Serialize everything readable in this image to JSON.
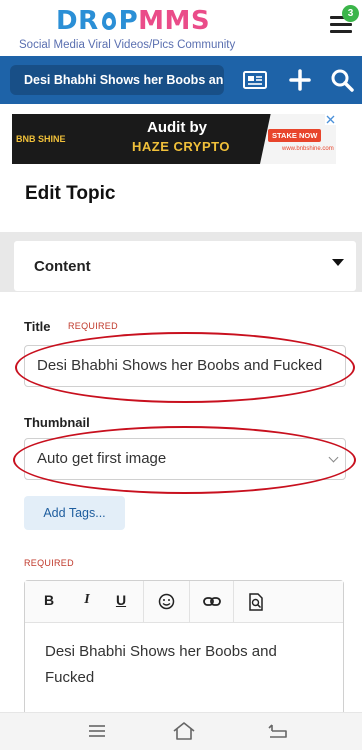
{
  "header": {
    "logo_left": "DR",
    "logo_mid": "P",
    "logo_right": "MMS",
    "tagline": "Social Media Viral Videos/Pics Community",
    "notification_count": "3"
  },
  "topbar": {
    "breadcrumb": "Desi Bhabhi Shows her Boobs an..."
  },
  "ad": {
    "brand": "BNB SHINE",
    "headline": "Audit by",
    "sponsor": "HAZE CRYPTO",
    "cta": "STAKE NOW",
    "site": "www.bnbshine.com"
  },
  "page": {
    "title": "Edit Topic"
  },
  "content_panel": {
    "label": "Content"
  },
  "form": {
    "title_label": "Title",
    "title_required": "REQUIRED",
    "title_value": "Desi Bhabhi Shows her Boobs and Fucked",
    "thumbnail_label": "Thumbnail",
    "thumbnail_value": "Auto get first image",
    "add_tags_label": "Add Tags...",
    "body_required": "REQUIRED",
    "body_text": "Desi Bhabhi Shows her Boobs and Fucked"
  },
  "editor_toolbar": {
    "bold": "B",
    "italic": "I",
    "underline": "U"
  },
  "colors": {
    "brand_blue": "#1e63a8",
    "logo_pink": "#ea4c89",
    "required_red": "#c0392b",
    "annotation_red": "#c8101e",
    "badge_green": "#3bb54a"
  }
}
